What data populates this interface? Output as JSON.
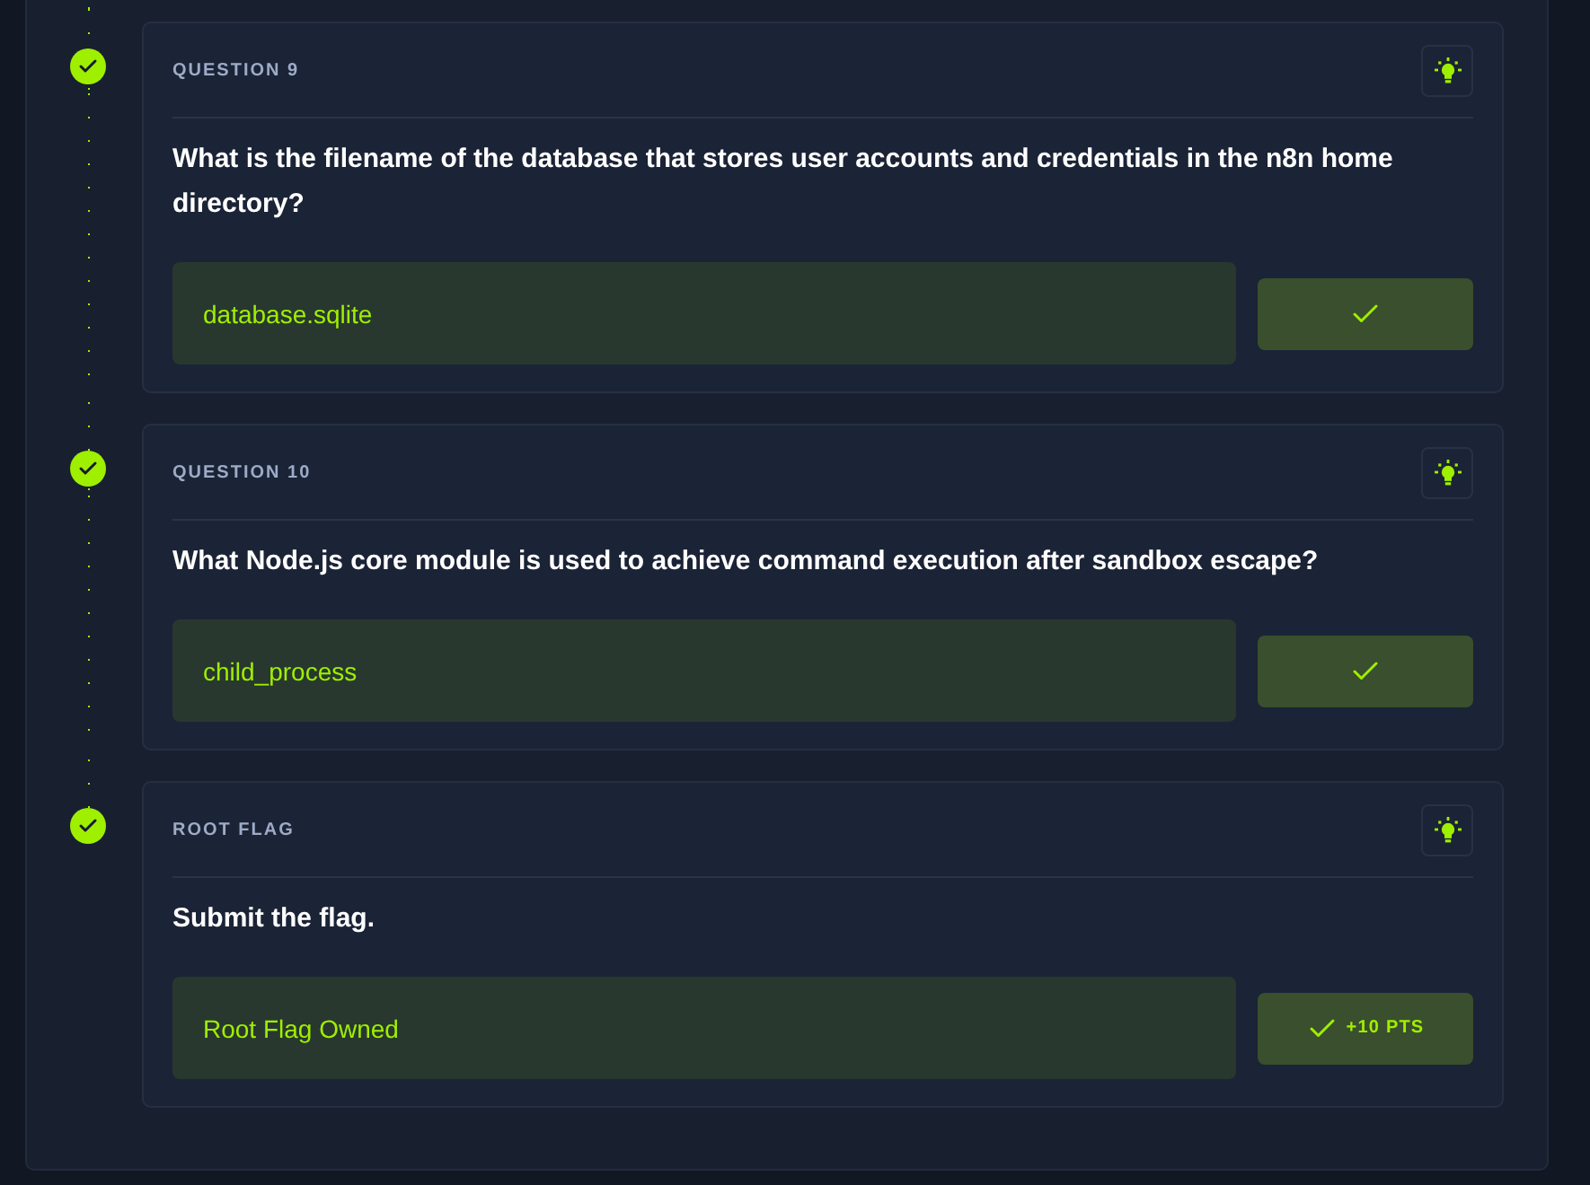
{
  "questions": [
    {
      "label": "QUESTION 9",
      "completed": true,
      "question": "What is the filename of the database that stores user accounts and credentials in the n8n home directory?",
      "answer": "database.sqlite"
    },
    {
      "label": "QUESTION 10",
      "completed": true,
      "question": "What Node.js core module is used to achieve command execution after sandbox escape?",
      "answer": "child_process"
    },
    {
      "label": "ROOT FLAG",
      "completed": true,
      "question": "Submit the flag.",
      "answer": "Root Flag Owned",
      "points": "+10 PTS"
    }
  ]
}
